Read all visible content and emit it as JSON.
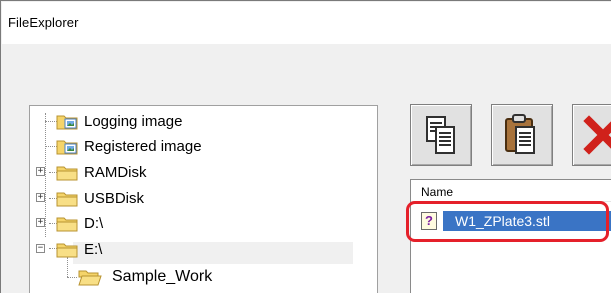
{
  "window": {
    "title": "FileExplorer"
  },
  "tree": {
    "items": [
      {
        "label": "Logging image",
        "icon": "picture-folder-icon"
      },
      {
        "label": "Registered image",
        "icon": "picture-folder-icon"
      },
      {
        "label": "RAMDisk",
        "icon": "folder-icon",
        "expander": "+"
      },
      {
        "label": "USBDisk",
        "icon": "folder-icon",
        "expander": "+"
      },
      {
        "label": "D:\\",
        "icon": "folder-icon",
        "expander": "+"
      },
      {
        "label": "E:\\",
        "icon": "folder-icon",
        "expander": "−"
      },
      {
        "label": "Sample_Work",
        "icon": "open-folder-icon",
        "selected": true
      }
    ]
  },
  "toolbar": {
    "buttons": [
      {
        "name": "copy",
        "icon": "copy-icon"
      },
      {
        "name": "paste",
        "icon": "paste-icon"
      },
      {
        "name": "delete",
        "icon": "delete-x-icon"
      }
    ]
  },
  "filelist": {
    "column_name": "Name",
    "files": [
      {
        "name": "W1_ZPlate3.stl",
        "icon": "unknown-file-icon",
        "icon_glyph": "?",
        "selected": true
      }
    ]
  },
  "colors": {
    "selection": "#3a74c5",
    "highlight_ring": "#e5202a",
    "folder": "#f5d46a",
    "delete": "#d0211b"
  }
}
